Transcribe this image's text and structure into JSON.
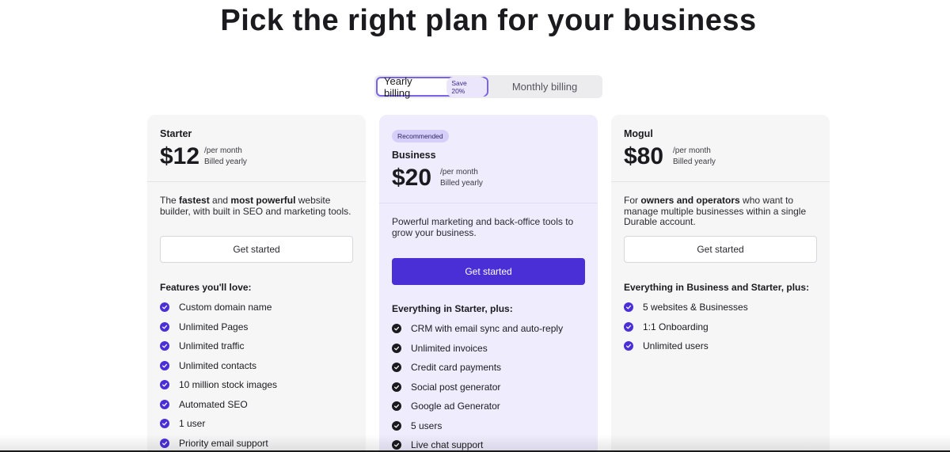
{
  "title": "Pick the right plan for your business",
  "billing": {
    "yearly_label": "Yearly billing",
    "save_badge": "Save 20%",
    "monthly_label": "Monthly billing",
    "selected": "yearly"
  },
  "plans": [
    {
      "name": "Starter",
      "price": "$12",
      "per": "/per month",
      "billed": "Billed yearly",
      "desc_parts": [
        "The ",
        "fastest",
        " and ",
        "most powerful",
        " website builder, with built in SEO and marketing tools."
      ],
      "cta": "Get started",
      "features_heading": "Features you'll love:",
      "features": [
        "Custom domain name",
        "Unlimited Pages",
        "Unlimited traffic",
        "Unlimited contacts",
        "10 million stock images",
        "Automated SEO",
        "1 user",
        "Priority email support"
      ]
    },
    {
      "badge": "Recommended",
      "name": "Business",
      "price": "$20",
      "per": "/per month",
      "billed": "Billed yearly",
      "desc": "Powerful marketing and back-office tools to grow your business.",
      "cta": "Get started",
      "features_heading": "Everything in Starter, plus:",
      "features": [
        "CRM with email sync and auto-reply",
        "Unlimited invoices",
        "Credit card payments",
        "Social post generator",
        "Google ad Generator",
        "5 users",
        "Live chat support"
      ]
    },
    {
      "name": "Mogul",
      "price": "$80",
      "per": "/per month",
      "billed": "Billed yearly",
      "desc_parts": [
        "For ",
        "owners and operators",
        " who want to manage multiple businesses within a single Durable account."
      ],
      "cta": "Get started",
      "features_heading": "Everything in Business and Starter, plus:",
      "features": [
        "5 websites & Businesses",
        "1:1 Onboarding",
        "Unlimited users"
      ]
    }
  ],
  "colors": {
    "accent": "#4a2fd6",
    "featured_bg": "#efecfd",
    "card_bg": "#f6f6f7",
    "badge_bg": "#d6cffa"
  }
}
